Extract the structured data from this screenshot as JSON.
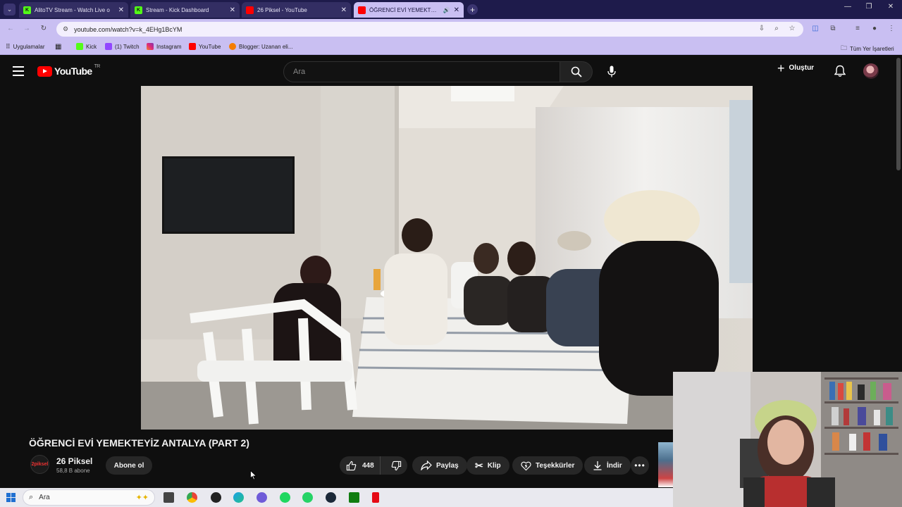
{
  "browser": {
    "tabs": [
      {
        "title": "AlitoTV Stream - Watch Live o",
        "favicon_color": "#53fc18",
        "active": false
      },
      {
        "title": "Stream - Kick Dashboard",
        "favicon_color": "#53fc18",
        "active": false
      },
      {
        "title": "26 Piksel - YouTube",
        "favicon_color": "#ff0000",
        "active": false
      },
      {
        "title": "ÖĞRENCİ EVİ YEMEKTEYİZ",
        "favicon_color": "#ff0000",
        "active": true
      }
    ],
    "url": "youtube.com/watch?v=k_4EHg1BcYM",
    "bookmarks": [
      {
        "label": "Uygulamalar"
      },
      {
        "label": "Kick"
      },
      {
        "label": "(1) Twitch"
      },
      {
        "label": "Instagram"
      },
      {
        "label": "YouTube"
      },
      {
        "label": "Blogger: Uzanan eli..."
      }
    ],
    "all_bookmarks_label": "Tüm Yer İşaretleri"
  },
  "youtube": {
    "logo_text": "YouTube",
    "region": "TR",
    "search_placeholder": "Ara",
    "create_label": "Oluştur"
  },
  "video": {
    "title": "ÖĞRENCİ EVİ YEMEKTEYİZ ANTALYA (PART 2)",
    "channel": {
      "name": "26 Piksel",
      "subscribers": "58,8 B abone",
      "avatar_text": "2piksel"
    },
    "subscribe_label": "Abone ol",
    "likes": "448",
    "share_label": "Paylaş",
    "clip_label": "Klip",
    "thanks_label": "Teşekkürler",
    "download_label": "İndir"
  },
  "taskbar": {
    "search_label": "Ara"
  },
  "colors": {
    "tabstrip": "#1e1b4b",
    "toolbar": "#c9bff2",
    "yt_red": "#ff0000",
    "yt_bg": "#0f0f0f"
  }
}
